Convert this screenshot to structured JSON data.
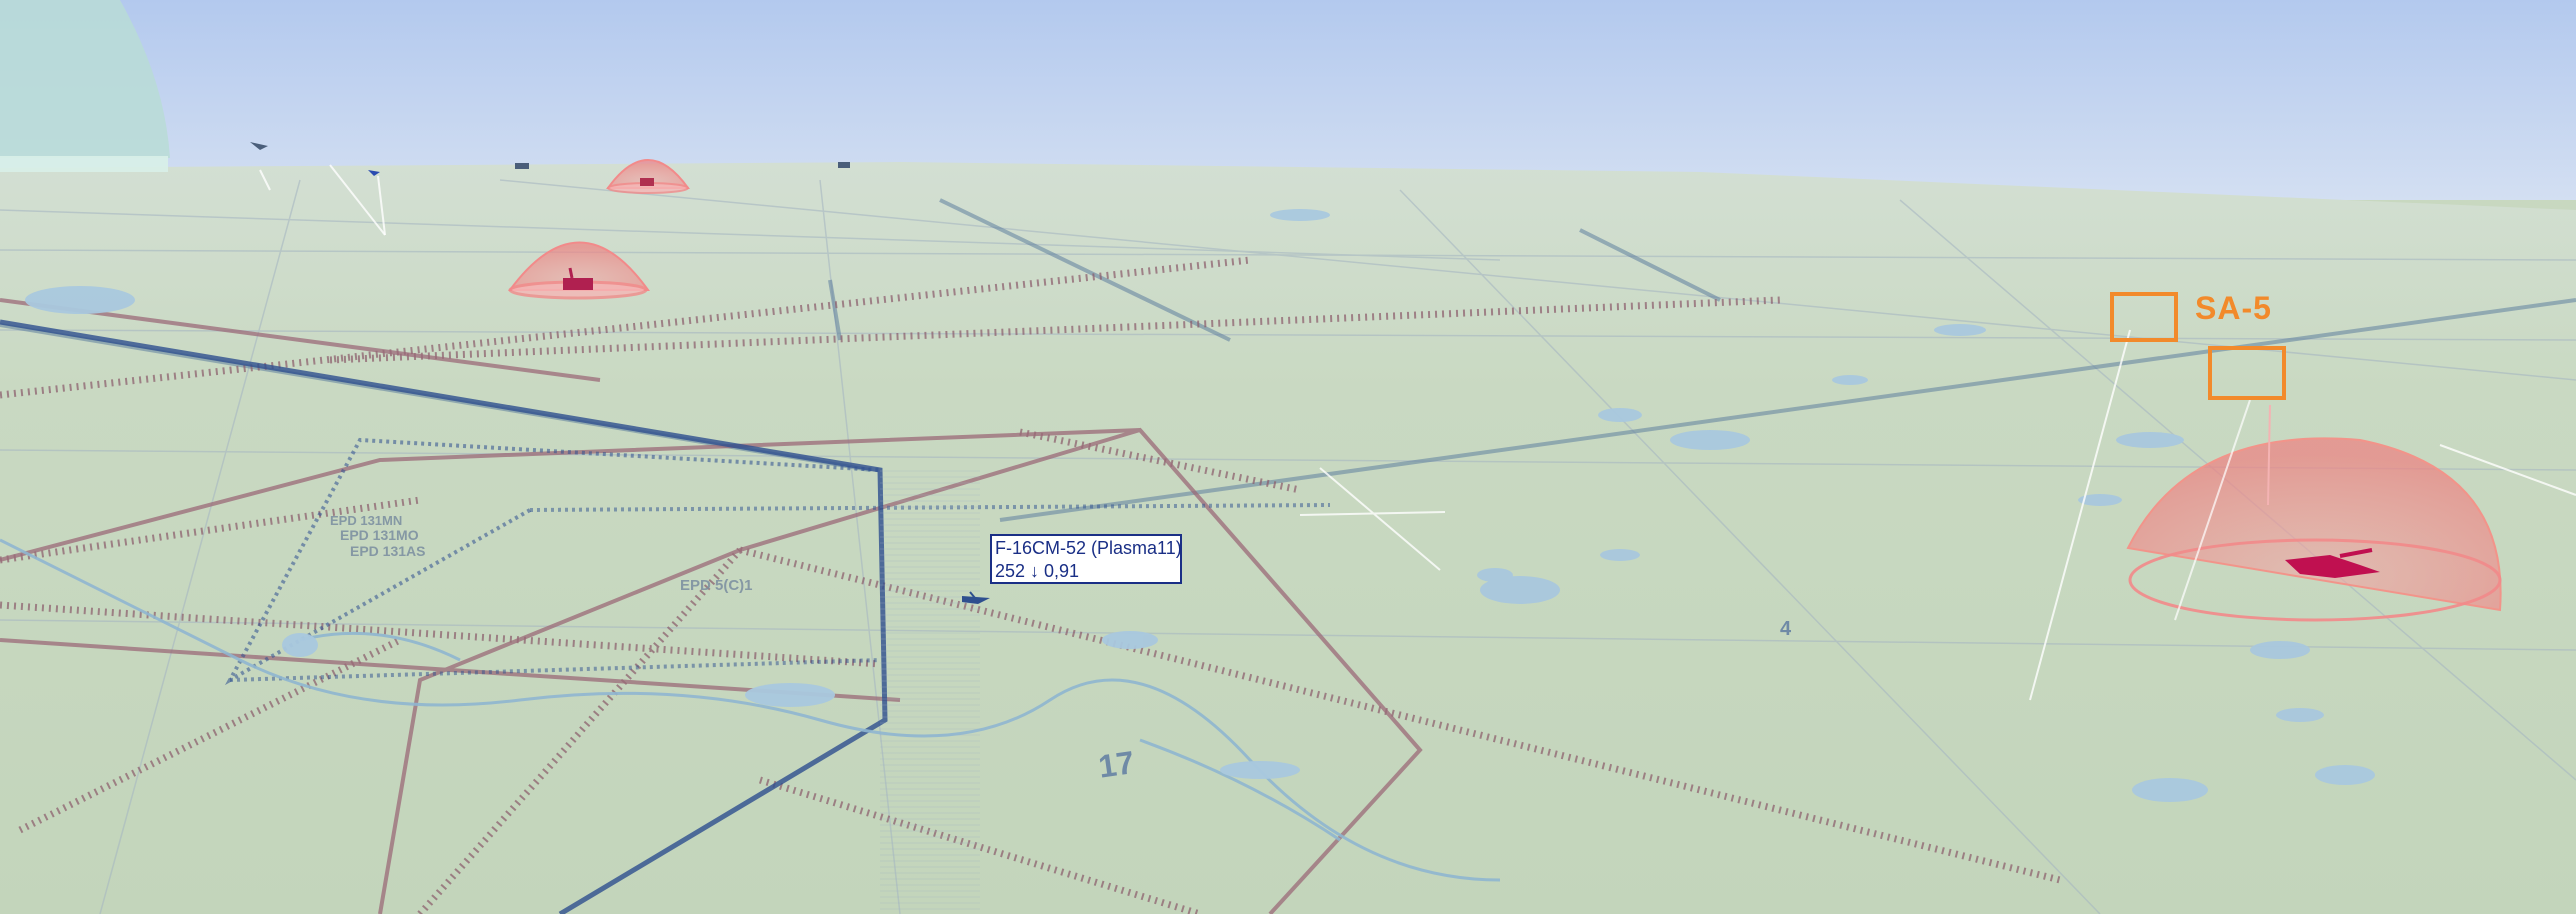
{
  "aircraft_label": {
    "callsign": "F-16CM-52 (Plasma11)",
    "info": "252 ↓ 0,91"
  },
  "threat": {
    "label": "SA-5",
    "color": "#f28a2b"
  },
  "map_labels": {
    "airspace_1": "EPD 131MO",
    "airspace_2": "EPD 131AS",
    "airspace_3": "EPD 131MN",
    "airspace_4": "EPD 5(C)1",
    "runway_number": "17",
    "grid_number": "4"
  },
  "colors": {
    "sky_top": "#b7ccee",
    "sky_horizon": "#cfdcf0",
    "terrain": "#c8d8c0",
    "water": "#a9c8de",
    "route_line": "#8a5a6a",
    "airspace_line": "#2e4f8f",
    "sam_dome": "#f08a8a",
    "label_border": "#1a2f86"
  },
  "icons": {
    "aircraft": "fighter-jet-icon",
    "sam_site": "sam-launcher-icon"
  }
}
